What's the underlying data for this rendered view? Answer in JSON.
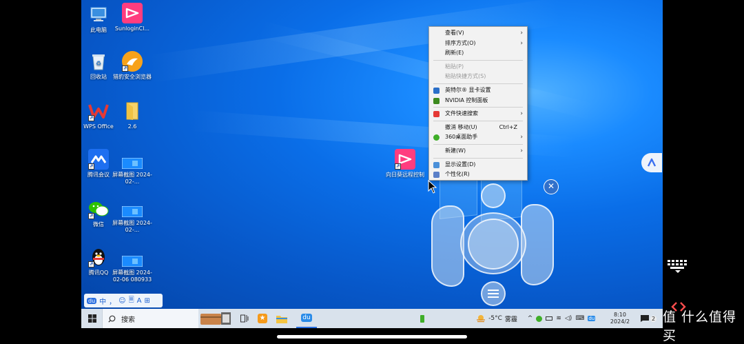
{
  "desktop": {
    "icons": [
      {
        "label": "此电脑",
        "icon": "computer-icon"
      },
      {
        "label": "SunloginCl...",
        "icon": "sunlogin-icon"
      },
      {
        "label": "回收站",
        "icon": "recycle-bin-icon"
      },
      {
        "label": "猎豹安全浏览器",
        "icon": "cheetah-browser-icon"
      },
      {
        "label": "WPS Office",
        "icon": "wps-icon"
      },
      {
        "label": "2.6",
        "icon": "folder-icon"
      },
      {
        "label": "腾讯会议",
        "icon": "tencent-meeting-icon"
      },
      {
        "label": "屏幕截图 2024-02-...",
        "icon": "screenshot-icon"
      },
      {
        "label": "微信",
        "icon": "wechat-icon"
      },
      {
        "label": "屏幕截图 2024-02-...",
        "icon": "screenshot-icon"
      },
      {
        "label": "腾讯QQ",
        "icon": "qq-icon"
      },
      {
        "label": "屏幕截图 2024-02-06 080933",
        "icon": "screenshot-icon"
      },
      {
        "label": "向日葵远程控制",
        "icon": "sunlogin-icon"
      }
    ]
  },
  "context_menu": {
    "items": [
      {
        "label": "查看(V)",
        "submenu": true
      },
      {
        "label": "排序方式(O)",
        "submenu": true
      },
      {
        "label": "刷新(E)"
      },
      {
        "label": "粘贴(P)",
        "disabled": true
      },
      {
        "label": "粘贴快捷方式(S)",
        "disabled": true
      },
      {
        "label": "英特尔® 显卡设置",
        "icon": "intel-graphics-icon"
      },
      {
        "label": "NVIDIA 控制面板",
        "icon": "nvidia-icon"
      },
      {
        "label": "文件快速搜索",
        "icon": "wps-search-icon",
        "submenu": true
      },
      {
        "label": "撤消 移动(U)",
        "shortcut": "Ctrl+Z"
      },
      {
        "label": "360桌面助手",
        "icon": "360-icon",
        "submenu": true
      },
      {
        "label": "新建(W)",
        "submenu": true
      },
      {
        "label": "显示设置(D)",
        "icon": "display-settings-icon"
      },
      {
        "label": "个性化(R)",
        "icon": "personalize-icon"
      }
    ]
  },
  "ime_bar": {
    "items": [
      "du",
      "中",
      "，",
      "☺",
      "🗏",
      "A",
      "⊞"
    ]
  },
  "taskbar": {
    "search_placeholder": "搜索",
    "weather_temp": "-5°C",
    "weather_desc": "雾霾",
    "time": "8:10",
    "date": "2024/2",
    "notification_count": "2",
    "tray_icons": [
      "chevron-up-icon",
      "360-tray-icon",
      "battery-icon",
      "wifi-icon",
      "volume-icon",
      "ime-icon",
      "baidu-ime-icon"
    ]
  },
  "colors": {
    "desktop_blue": "#0a6ee8",
    "taskbar_bg": "#d9e2ec",
    "sunlogin_pink": "#ff3d7f",
    "menu_bg": "#f2f2f2"
  }
}
